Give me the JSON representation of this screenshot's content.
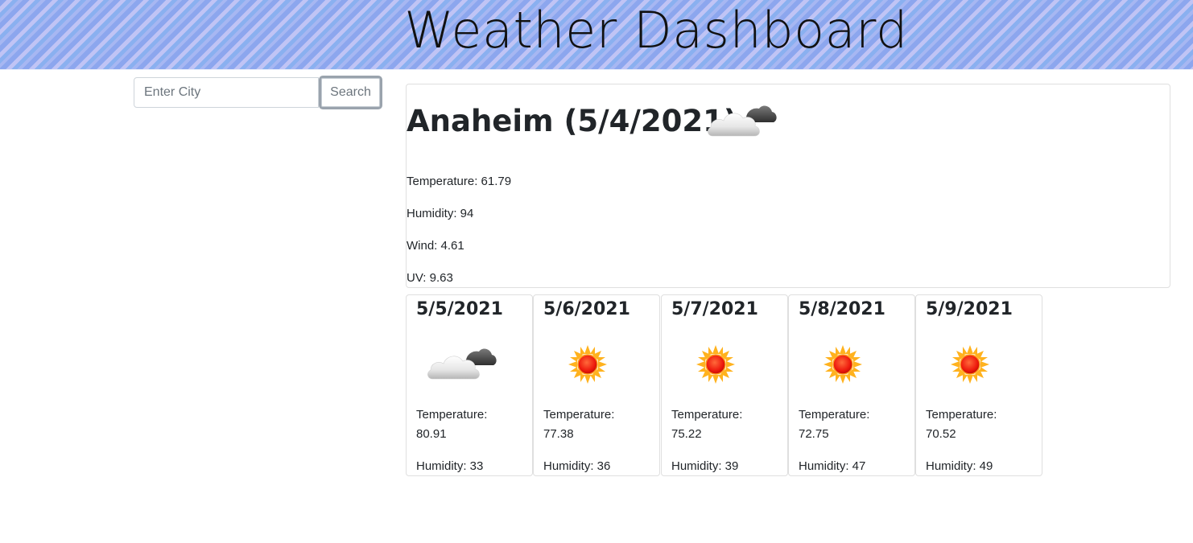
{
  "header": {
    "title": "Weather Dashboard"
  },
  "search": {
    "placeholder": "Enter City",
    "value": "",
    "button_label": "Search"
  },
  "current": {
    "title": "Anaheim (5/4/2021)",
    "icon": "partly-cloudy-icon",
    "temperature": "Temperature: 61.79",
    "humidity": "Humidity: 94",
    "wind": "Wind: 4.61",
    "uv": "UV: 9.63"
  },
  "forecast": [
    {
      "date": "5/5/2021",
      "icon": "partly-cloudy-icon",
      "temp_label": "Temperature:",
      "temp_value": "80.91",
      "humidity": "Humidity: 33"
    },
    {
      "date": "5/6/2021",
      "icon": "sun-icon",
      "temp_label": "Temperature:",
      "temp_value": "77.38",
      "humidity": "Humidity: 36"
    },
    {
      "date": "5/7/2021",
      "icon": "sun-icon",
      "temp_label": "Temperature:",
      "temp_value": "75.22",
      "humidity": "Humidity: 39"
    },
    {
      "date": "5/8/2021",
      "icon": "sun-icon",
      "temp_label": "Temperature:",
      "temp_value": "72.75",
      "humidity": "Humidity: 47"
    },
    {
      "date": "5/9/2021",
      "icon": "sun-icon",
      "temp_label": "Temperature:",
      "temp_value": "70.52",
      "humidity": "Humidity: 49"
    }
  ],
  "colors": {
    "header_stripe_a": "#8ca6ee",
    "header_stripe_b": "#c0c4f5",
    "text": "#212529",
    "card_border": "#dfdfdf"
  }
}
